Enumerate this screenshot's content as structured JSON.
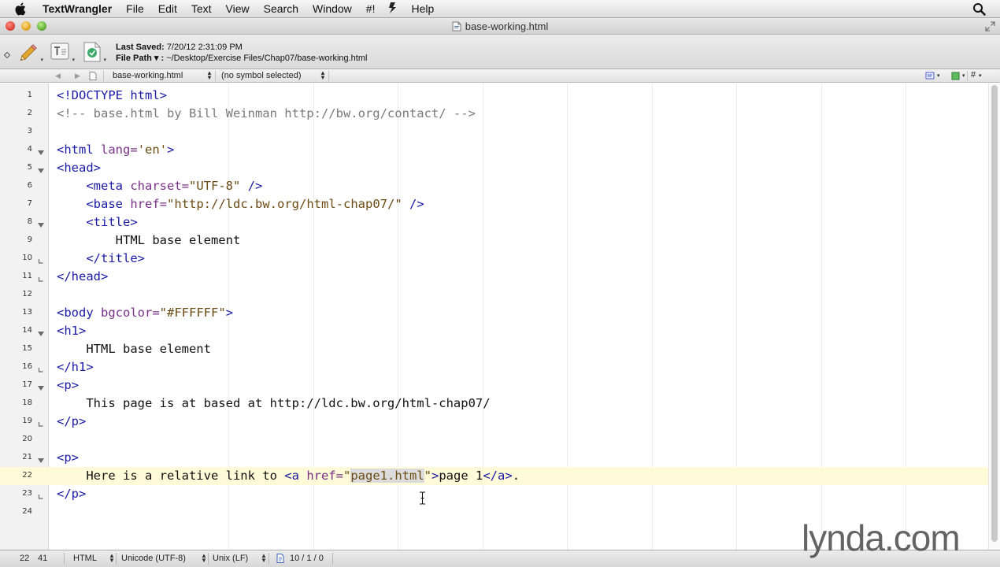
{
  "menubar": {
    "app_name": "TextWrangler",
    "items": [
      "File",
      "Edit",
      "Text",
      "View",
      "Search",
      "Window",
      "#!",
      "Help"
    ]
  },
  "window": {
    "title": "base-working.html"
  },
  "toolbar": {
    "last_saved_label": "Last Saved:",
    "last_saved_value": "7/20/12 2:31:09 PM",
    "file_path_label": "File Path ▾ :",
    "file_path_value": "~/Desktop/Exercise Files/Chap07/base-working.html"
  },
  "navbar": {
    "file_name": "base-working.html",
    "symbol": "(no symbol selected)"
  },
  "editor": {
    "current_line": 22,
    "selected_text": "page1.html",
    "lines": [
      {
        "n": "1",
        "fold": "",
        "code": "<!DOCTYPE html>"
      },
      {
        "n": "2",
        "fold": "",
        "code": "<!-- base.html by Bill Weinman http://bw.org/contact/ -->"
      },
      {
        "n": "3",
        "fold": "",
        "code": ""
      },
      {
        "n": "4",
        "fold": "open",
        "code": "<html lang='en'>"
      },
      {
        "n": "5",
        "fold": "open",
        "code": "<head>"
      },
      {
        "n": "6",
        "fold": "",
        "code": "    <meta charset=\"UTF-8\" />"
      },
      {
        "n": "7",
        "fold": "",
        "code": "    <base href=\"http://ldc.bw.org/html-chap07/\" />"
      },
      {
        "n": "8",
        "fold": "open",
        "code": "    <title>"
      },
      {
        "n": "9",
        "fold": "",
        "code": "        HTML base element"
      },
      {
        "n": "10",
        "fold": "end",
        "code": "    </title>"
      },
      {
        "n": "11",
        "fold": "end",
        "code": "</head>"
      },
      {
        "n": "12",
        "fold": "",
        "code": ""
      },
      {
        "n": "13",
        "fold": "",
        "code": "<body bgcolor=\"#FFFFFF\">"
      },
      {
        "n": "14",
        "fold": "open",
        "code": "<h1>"
      },
      {
        "n": "15",
        "fold": "",
        "code": "    HTML base element"
      },
      {
        "n": "16",
        "fold": "end",
        "code": "</h1>"
      },
      {
        "n": "17",
        "fold": "open",
        "code": "<p>"
      },
      {
        "n": "18",
        "fold": "",
        "code": "    This page is at based at http://ldc.bw.org/html-chap07/"
      },
      {
        "n": "19",
        "fold": "end",
        "code": "</p>"
      },
      {
        "n": "20",
        "fold": "",
        "code": ""
      },
      {
        "n": "21",
        "fold": "open",
        "code": "<p>"
      },
      {
        "n": "22",
        "fold": "",
        "code": "    Here is a relative link to <a href=\"page1.html\">page 1</a>."
      },
      {
        "n": "23",
        "fold": "end",
        "code": "</p>"
      },
      {
        "n": "24",
        "fold": "",
        "code": ""
      }
    ]
  },
  "statusbar": {
    "line": "22",
    "column": "41",
    "language": "HTML",
    "encoding": "Unicode (UTF-8)",
    "line_endings": "Unix (LF)",
    "counts": "10 / 1 / 0"
  },
  "watermark": {
    "text": "lynda.com"
  },
  "colors": {
    "tag": "#1a1aa6",
    "attribute": "#7a2f8a",
    "string": "#6b4b13",
    "comment": "#7a7a7a",
    "current_line": "#fffbd8"
  }
}
